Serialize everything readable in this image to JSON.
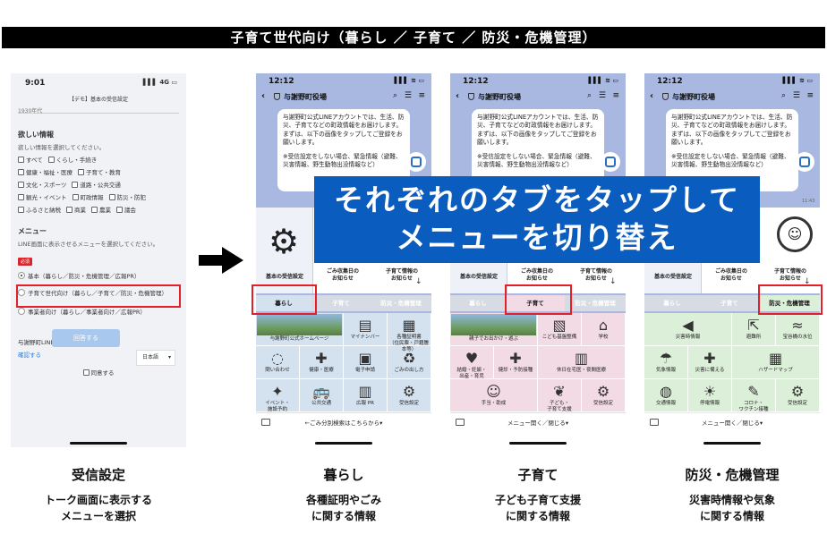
{
  "title": "子育て世代向け（暮らし ／ 子育て ／ 防災・危機管理）",
  "settings_phone": {
    "time": "9:01",
    "signal": "▌▌▌ 4G ▭",
    "header": "【デモ】基本の受信設定",
    "clipped_value": "1930年代",
    "info_heading": "欲しい情報",
    "info_sub": "欲しい情報を選択してください。",
    "checkboxes": [
      [
        "すべて",
        "くらし・手続き"
      ],
      [
        "健康・福祉・医療",
        "子育て・教育"
      ],
      [
        "文化・スポーツ",
        "道路・公共交通"
      ],
      [
        "観光・イベント",
        "町政情報",
        "防災・防犯"
      ],
      [
        "ふるさと納税",
        "商業",
        "農業",
        "議会"
      ]
    ],
    "menu_heading": "メニュー",
    "menu_sub": "LINE画面に表示させるメニューを選択してください。",
    "required": "必須",
    "radios": [
      "基本（暮らし／防災・危機管理／広報PR）",
      "子育て世代向け（暮らし／子育て／防災・危機管理）",
      "事業者向け（暮らし／事業者向け／広報PR）"
    ],
    "policy": "与謝野町LINE運用ポリシー",
    "confirm_link": "確認する",
    "agree": "同意する",
    "submit": "回答する",
    "lang": "日本語"
  },
  "chat": {
    "time": "12:12",
    "signal": "▌▌▌ ≋ ▭",
    "account": "与謝野町役場",
    "message": "与謝野町公式LINEアカウントでは、生活、防災、子育てなどの町政情報をお届けします。まずは、以下の画像をタップしてご登録をお願いします。",
    "message2": "※受信設定をしない場合、緊急情報（避難、災害情報、野生動物出没情報など）",
    "msg_time": "11:43",
    "top_menu": {
      "basic": "基本の受信設定",
      "garbage": "ごみ収集日の\nお知らせ",
      "kosodate": "子育て情報の\nお知らせ"
    },
    "tabs": [
      "暮らし",
      "子育て",
      "防災・危機管理"
    ]
  },
  "panels": [
    {
      "grid": [
        {
          "label": "与謝野町公式ホームページ",
          "icon": "town-photo"
        },
        {
          "label": "マイナンバー",
          "icon": "id-card-icon",
          "glyph": "▤"
        },
        {
          "label": "各種証明書\n（住民票・戸籍謄本等）",
          "icon": "certificate-icon",
          "glyph": "▦"
        },
        {
          "label": "問い合わせ",
          "icon": "chat-icon",
          "glyph": "◌"
        },
        {
          "label": "健康・医療",
          "icon": "medical-icon",
          "glyph": "✚"
        },
        {
          "label": "電子申請",
          "icon": "e-apply-icon",
          "glyph": "▣"
        },
        {
          "label": "ごみの出し方",
          "icon": "trash-icon",
          "glyph": "♻"
        },
        {
          "label": "イベント・\n施設予約",
          "icon": "event-icon",
          "glyph": "✦"
        },
        {
          "label": "公共交通",
          "icon": "bus-icon",
          "glyph": "🚌"
        },
        {
          "label": "広報 PR",
          "icon": "news-icon",
          "glyph": "▥"
        },
        {
          "label": "受信設定",
          "icon": "gear-icon",
          "glyph": "⚙"
        }
      ],
      "footer": "←ごみ分別検索はこちらから▾"
    },
    {
      "grid": [
        {
          "label": "親子でお出かけ・遊ぶ",
          "icon": "park-photo"
        },
        {
          "label": "こども基盤整備",
          "icon": "school-bag-icon",
          "glyph": "▧"
        },
        {
          "label": "学校",
          "icon": "school-icon",
          "glyph": "⌂"
        },
        {
          "label": "結婚・妊娠・\n出産・育児",
          "icon": "baby-carriage-icon",
          "glyph": "♥"
        },
        {
          "label": "健診・予防接種",
          "icon": "stethoscope-icon",
          "glyph": "✚"
        },
        {
          "label": "休日在宅医・夜間医療",
          "icon": "hospital-icon",
          "glyph": "▥"
        },
        {
          "label": "手当・助成",
          "icon": "handshake-icon",
          "glyph": "☺"
        },
        {
          "label": "子ども・\n子育て支援",
          "icon": "sprout-icon",
          "glyph": "❦"
        },
        {
          "label": "受信設定",
          "icon": "gear-icon",
          "glyph": "⚙"
        }
      ],
      "footer": "メニュー開く／閉じる▾"
    },
    {
      "grid": [
        {
          "label": "災害時情報",
          "icon": "megaphone-icon",
          "glyph": "◀"
        },
        {
          "label": "避難所",
          "icon": "evacuation-icon",
          "glyph": "⇱"
        },
        {
          "label": "宝谷橋の水位",
          "icon": "water-level-icon",
          "glyph": "≈"
        },
        {
          "label": "気象情報",
          "icon": "weather-icon",
          "glyph": "☂"
        },
        {
          "label": "災害に備える",
          "icon": "first-aid-icon",
          "glyph": "✚"
        },
        {
          "label": "ハザードマップ",
          "icon": "map-icon",
          "glyph": "▦"
        },
        {
          "label": "交通情報",
          "icon": "car-icon",
          "glyph": "◍"
        },
        {
          "label": "停電情報",
          "icon": "bulb-icon",
          "glyph": "☀"
        },
        {
          "label": "コロナ・\nワクチン接種",
          "icon": "syringe-icon",
          "glyph": "✎"
        },
        {
          "label": "受信設定",
          "icon": "gear-icon",
          "glyph": "⚙"
        }
      ],
      "footer": "メニュー開く／閉じる▾"
    }
  ],
  "banner": {
    "line1": "それぞれのタブをタップして",
    "line2": "メニューを切り替え"
  },
  "captions": [
    {
      "title": "受信設定",
      "sub1": "トーク画面に表示する",
      "sub2": "メニューを選択"
    },
    {
      "title": "暮らし",
      "sub1": "各種証明やごみ",
      "sub2": "に関する情報"
    },
    {
      "title": "子育て",
      "sub1": "子ども子育て支援",
      "sub2": "に関する情報"
    },
    {
      "title": "防災・危機管理",
      "sub1": "災害時情報や気象",
      "sub2": "に関する情報"
    }
  ],
  "colors": {
    "accent_blue": "#0b5cbf",
    "highlight_red": "#e3202a",
    "kurashi_bg": "#d4e2f0",
    "kosodate_bg": "#f3dbe6",
    "bousai_bg": "#dcefd8"
  }
}
